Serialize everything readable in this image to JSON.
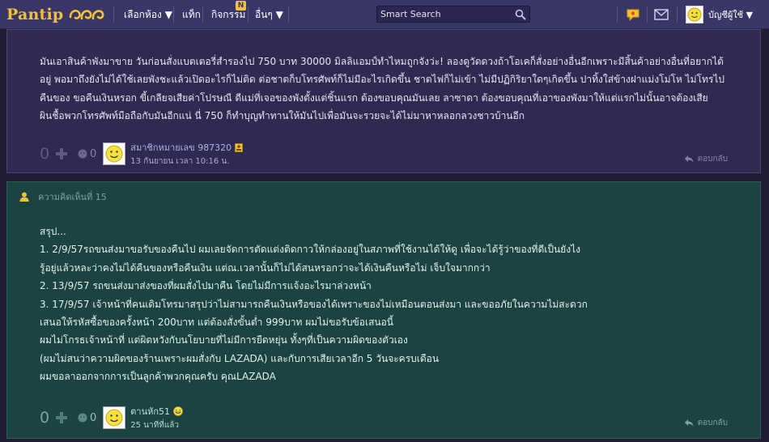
{
  "navbar": {
    "logo_text": "Pantip",
    "items": [
      {
        "label": "เลือกห้อง ▼"
      },
      {
        "label": "แท็ก"
      },
      {
        "label": "กิจกรรม"
      },
      {
        "label": "อื่นๆ ▼"
      }
    ],
    "activity_badge": "N",
    "search_placeholder": "Smart Search",
    "user_label": "บัญชีผู้ใช้ ▼"
  },
  "comments": [
    {
      "lines": [
        "มันเอาสินค้าพังมาขาย วันก่อนสั่งแบตเตอรี่สำรองไป 750 บาท 30000 มิลลิแอมป์ทำไหมถูกจังว่ะ! ลองดูวัดดวงถ้าโอเคก็สั่งอย่างอื่นอีกเพราะมีสิ้นค้าอย่างอื่นที่อยากได้",
        "อยู่ พอมาถึงยังไม่ได้ใช้เลยพังชะแล้วเปิดอะไรก็ไม่ติด ต่อชาตก็บโทรศัพท์ก็ไม่มีอะไรเกิดขึ้น ชาตไฟก็ไม่เข้า ไม่มีปฏิกิริยาใดๆเกิดขึ้น ปาทิ้งใส่ข้างฝาแม่งโม่โห ไม่โทรไป",
        "คืนของ ขอคืนเงินหรอก ขี้เกลียจเสียค่าโปรษณี ดีแม่ที่เจอของพังตั้งแต่ชิ้นแรก ต้องขอบคุณมันเลย ลาซาดา ต้องขอบคุณที่เอาของพังมาให้แต่แรกไม่นั้นอาจต้องเสีย",
        "ผินชื้อพวกโทรศัพท์มือถือกับมันอีกแน่ นี่ 750 ก็ทำบุญทำทานให้มันไปเพื่อมันจะรวยจะได้ไม่มาหาหลอกลวงชาวบ้านอีก"
      ],
      "votes": "0",
      "emotions": "0",
      "member": "สมาชิกหมายเลข 987320",
      "time": "13 กันยายน เวลา 10:16 น.",
      "reply": "ตอบกลับ"
    },
    {
      "header": "ความคิดเห็นที่ 15",
      "lines": [
        "สรุป...",
        "1. 2/9/57รถขนส่งมาขอรับของคืนไป  ผมเลยจัดการตัดแต่งติดกาวให้กล่องอยู่ในสภาพที่ใช้งานได้ให้ดู เพื่อจะได้รู้ว่าของที่ดีเป็นยังไง",
        "รู้อยู่แล้วหละว่าคงไม่ได้คืนของหรือคืนเงิน  แต่ณ.เวลานั้นก็ไม่ได้สนหรอกว่าจะได้เงินคืนหรือไม่ เจ็บใจมากกว่า",
        "2. 13/9/57 รถขนส่งมาส่งของที่ผมสั่งไปมาคืน โดยไม่มีการแจ้งอะไรมาล่วงหน้า",
        "3. 17/9/57 เจ้าหน้าที่คนเดิมโทรมาสรุปว่าไม่สามารถคืนเงินหรือของได้เพราะของไม่เหมือนตอนส่งมา  และขออภัยในความไม่สะดวก",
        "เสนอให้รหัสซื้อของครั้งหน้า 200บาท แต่ต้องสั่งขั้นต่ำ 999บาท ผมไม่ขอรับข้อเสนอนี้",
        "ผมไม่โกรธเจ้าหน้าที่  แต่ผิดหวังกับนโยบายที่ไม่มีการยืดหยุ่น  ทั้งๆที่เป็นความผิดของตัวเอง",
        "(ผมไม่สนว่าความผิดของร้านเพราะผมสั่งกับ LAZADA) และกับการเสียเวลาอีก 5 วันจะครบเดือน",
        "ผมขอลาออกจากการเป็นลูกค้าพวกคุณครับ คุณLAZADA"
      ],
      "votes": "0",
      "emotions": "0",
      "member": "ตานหัก51",
      "time": "25 นาทีที่แล้ว",
      "reply": "ตอบกลับ"
    }
  ],
  "colors": {
    "navbar": "#3b3668",
    "logo": "#f2c233",
    "page_bg": "#1f1c34",
    "comment_bg": "#2f2a52",
    "highlight_comment_bg": "#1b4342"
  }
}
